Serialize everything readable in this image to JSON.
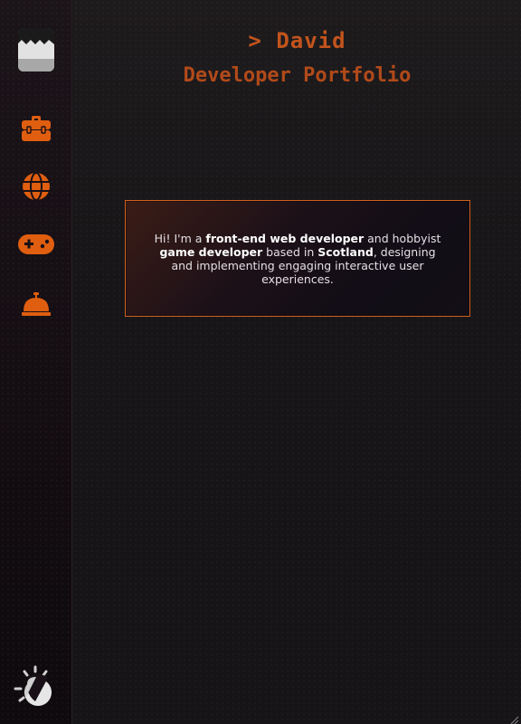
{
  "header": {
    "name": "> David",
    "subtitle": "Developer Portfolio"
  },
  "nav": {
    "logo_icon": "envelope-logo-icon",
    "items": [
      {
        "id": "work",
        "icon": "toolbox-icon"
      },
      {
        "id": "web",
        "icon": "globe-icon"
      },
      {
        "id": "games",
        "icon": "gamepad-icon"
      },
      {
        "id": "services",
        "icon": "service-bell-icon"
      }
    ],
    "theme_toggle_icon": "sun-moon-icon"
  },
  "intro": {
    "p1": "Hi! I'm a ",
    "b1": "front-end web developer",
    "p2": " and hobbyist ",
    "b2": "game developer",
    "p3": " based in ",
    "b3": "Scotland",
    "p4": ", designing and implementing engaging interactive user experiences."
  },
  "colors": {
    "accent": "#c2541c",
    "icon_orange": "#e05e10",
    "sidebar_bg": "#140d12",
    "main_bg": "#171517",
    "card_border": "#d0601f",
    "text": "#e4e0e4"
  }
}
